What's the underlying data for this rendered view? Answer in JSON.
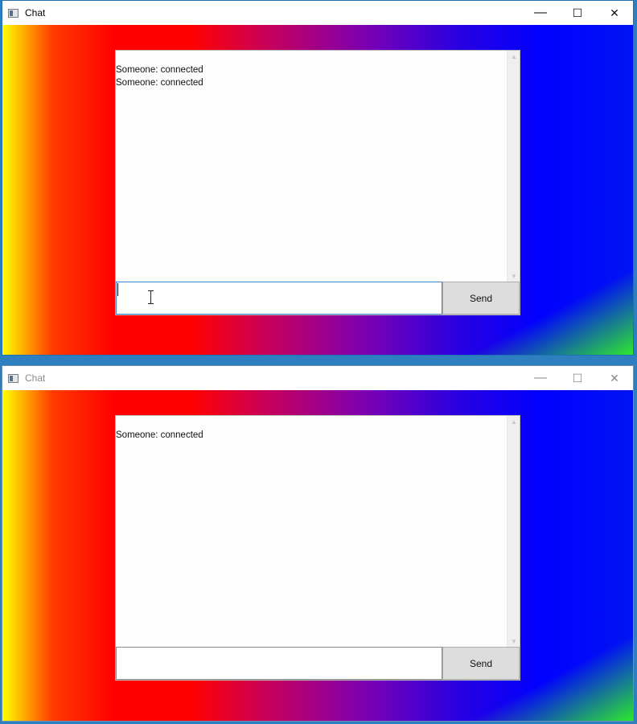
{
  "windows": [
    {
      "title": "Chat",
      "messages": [
        "Someone: connected",
        "Someone: connected"
      ],
      "input_value": "",
      "send_label": "Send",
      "caption": {
        "minimize": "—",
        "maximize": "☐",
        "close": "✕"
      },
      "focused": true
    },
    {
      "title": "Chat",
      "messages": [
        "Someone: connected"
      ],
      "input_value": "",
      "send_label": "Send",
      "caption": {
        "minimize": "—",
        "maximize": "☐",
        "close": "✕"
      },
      "focused": false
    }
  ],
  "colors": {
    "gradient": [
      "#ffff00",
      "#ff0000",
      "#7a00b4",
      "#0000ff",
      "#2ee62e"
    ],
    "focus_border": "#3b87d4",
    "button_bg": "#dddddd"
  },
  "icons": [
    "app-window-icon",
    "minimize-icon",
    "maximize-icon",
    "close-icon",
    "scroll-up-icon",
    "scroll-down-icon",
    "text-cursor-icon"
  ]
}
